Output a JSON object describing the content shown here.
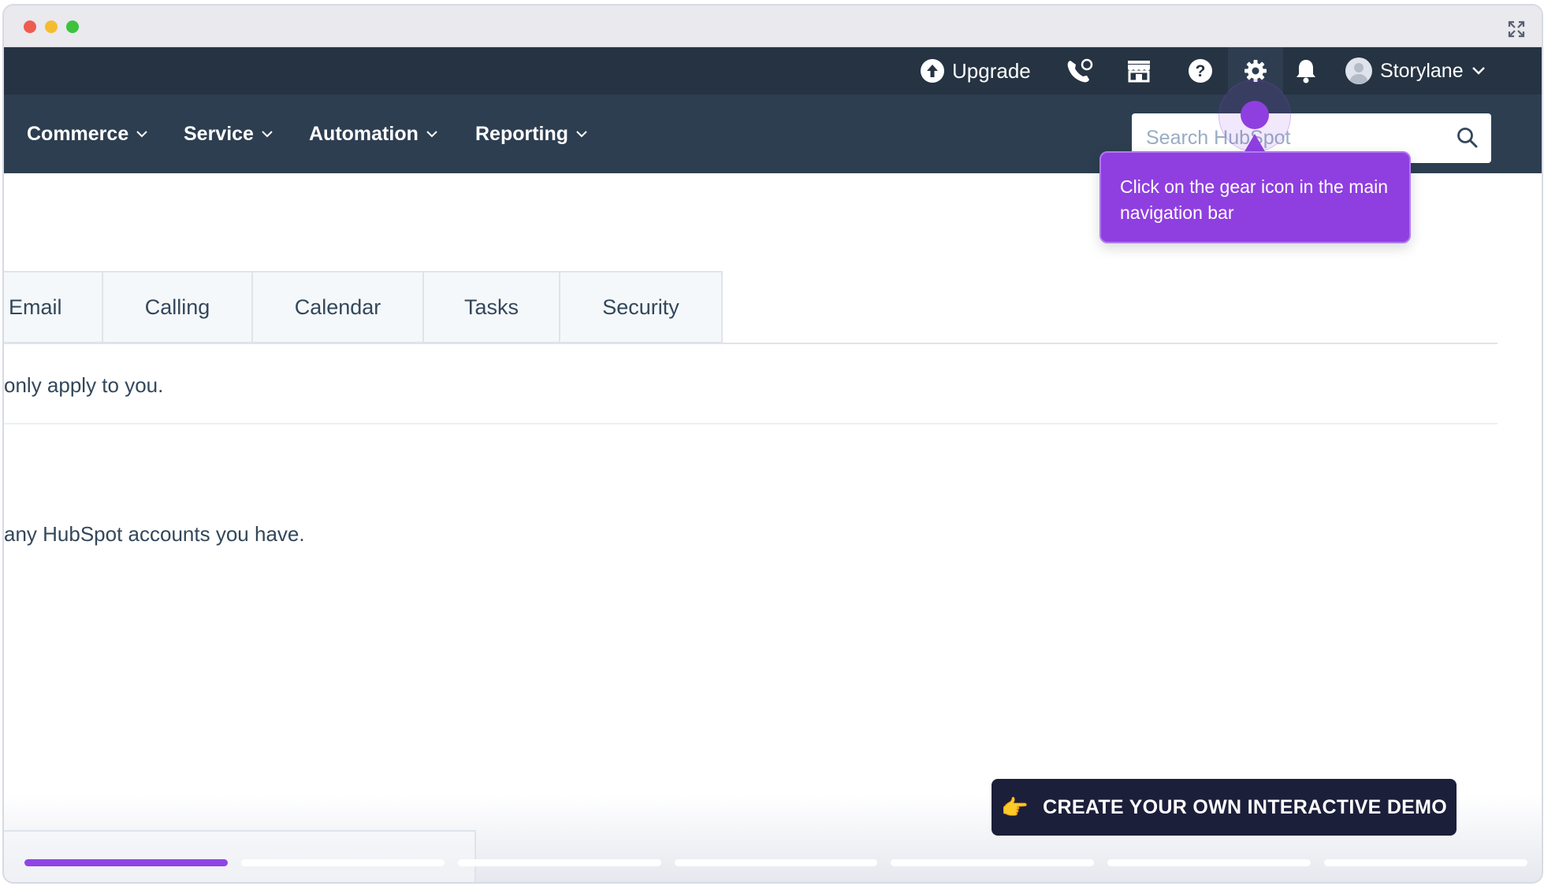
{
  "topbar": {
    "upgrade_label": "Upgrade",
    "user_name": "Storylane"
  },
  "mainnav": {
    "items": [
      {
        "label": "Commerce"
      },
      {
        "label": "Service"
      },
      {
        "label": "Automation"
      },
      {
        "label": "Reporting"
      }
    ],
    "search_placeholder": "Search HubSpot"
  },
  "tabs": [
    {
      "label": "Email"
    },
    {
      "label": "Calling"
    },
    {
      "label": "Calendar"
    },
    {
      "label": "Tasks"
    },
    {
      "label": "Security"
    }
  ],
  "content": {
    "line1": "only apply to you.",
    "line2": "any HubSpot accounts you have."
  },
  "tooltip": {
    "text": "Click on the gear icon in the main navigation bar"
  },
  "cta": {
    "hand_icon": "👉",
    "label": "CREATE YOUR OWN INTERACTIVE DEMO"
  },
  "progress": {
    "total_steps": 7,
    "current_step": 1
  },
  "colors": {
    "topbar_bg": "#253342",
    "nav_bg": "#2d3e50",
    "accent_purple": "#8f3fe0",
    "cta_bg": "#1c1f3a"
  }
}
